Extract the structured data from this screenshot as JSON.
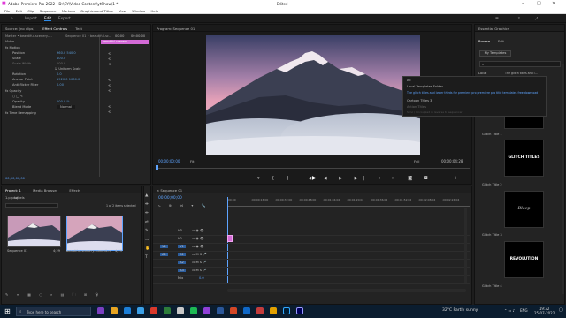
{
  "window": {
    "title": "Adobe Premiere Pro 2022 - D:\\CY\\Video Content\\ytShow\\1 *",
    "center_title": "- Edited"
  },
  "menu": [
    "File",
    "Edit",
    "Clip",
    "Sequence",
    "Markers",
    "Graphics and Titles",
    "View",
    "Window",
    "Help"
  ],
  "workspaces": {
    "home": "⌂",
    "import": "Import",
    "edit": "Edit",
    "export": "Export"
  },
  "effect_controls": {
    "tabs": [
      "Source: (no clips)",
      "Effect Controls",
      "Text",
      "Audio Clip Mixer: Sequence 01"
    ],
    "source": "Master • beautiful-scenery-...",
    "sequence": "Sequence 01 • beautiful-sc...",
    "time_start": "00:00",
    "time_end": "00:00:00",
    "clip_label": "beautiful-scenery-...",
    "video_label": "Video",
    "rows": [
      {
        "name": "fx  Motion",
        "value": ""
      },
      {
        "name": "Position",
        "value": "960.0   540.0"
      },
      {
        "name": "Scale",
        "value": "100.0"
      },
      {
        "name": "Scale Width",
        "value": "100.0"
      },
      {
        "name": "",
        "value": "☑ Uniform Scale"
      },
      {
        "name": "Rotation",
        "value": "0.0"
      },
      {
        "name": "Anchor Point",
        "value": "1920.0  1080.0"
      },
      {
        "name": "Anti-flicker Filter",
        "value": "0.00"
      },
      {
        "name": "fx  Opacity",
        "value": ""
      },
      {
        "name": "Opacity",
        "value": "100.0 %"
      },
      {
        "name": "Blend Mode",
        "value": "Normal"
      },
      {
        "name": "fx  Time Remapping",
        "value": ""
      }
    ],
    "timecode": "00;00;00;00"
  },
  "program": {
    "title": "Program: Sequence 01",
    "timecode": "00;00;00;00",
    "fit": "Fit",
    "full": "Full",
    "duration": "00;00;04;28"
  },
  "context_menu": {
    "items": [
      "All",
      "Local Templates Folder",
      "The glitch titles and lower thirds for premiere pro premiere pro title templates free download",
      "Cartoon Titles 3",
      "Action Titles",
      "Sync / Uncoupled in reverse to sequencer"
    ]
  },
  "essential_graphics": {
    "title": "Essential Graphics",
    "tabs": [
      "Browse",
      "Edit"
    ],
    "my_templates": "My Templates",
    "search_placeholder": "",
    "local_label": "Local",
    "dropdown_value": "The glitch titles and l...",
    "templates": [
      {
        "label": "Glitch Title 1",
        "text": ""
      },
      {
        "label": "Glitch Title 2",
        "text": "GLITCH TITLES"
      },
      {
        "label": "Glitch Title 3",
        "text": "Bleep"
      },
      {
        "label": "Glitch Title 4",
        "text": "REVOLUTION"
      }
    ]
  },
  "project": {
    "tabs": [
      "Project: 1",
      "Media Browser",
      "Effects"
    ],
    "path": "1.prproj",
    "labels": "Labels",
    "items_selected": "1 of 2 items selected",
    "items": [
      {
        "name": "Sequence 01",
        "duration": "4;29"
      },
      {
        "name": "beautiful-scenery-summit-m...",
        "duration": "4;29"
      }
    ]
  },
  "timeline": {
    "title": "Sequence 01",
    "timecode": "00;00;00;00",
    "ruler": [
      ";00;00",
      ";00;00;16;00",
      ";00;00;32;00",
      ";00;00;48;00",
      ";00;01;04;02",
      ";00;01;20;02",
      ";00;01;36;02",
      ";00;01;52;02",
      ";00;02;08;04",
      ";00;02;24;04"
    ],
    "tracks": [
      "V3",
      "V2",
      "V1",
      "A1",
      "A2",
      "A3",
      "Mix"
    ],
    "mix_value": "0.0"
  },
  "taskbar": {
    "search_placeholder": "Type here to search",
    "weather": "32°C  Partly sunny",
    "lang": "ENG",
    "time": "19:32",
    "date": "25-07-2022"
  },
  "colors": {
    "accent": "#2d8ceb",
    "clip_pink": "#d36ad6",
    "playhead": "#5ea4ff"
  }
}
